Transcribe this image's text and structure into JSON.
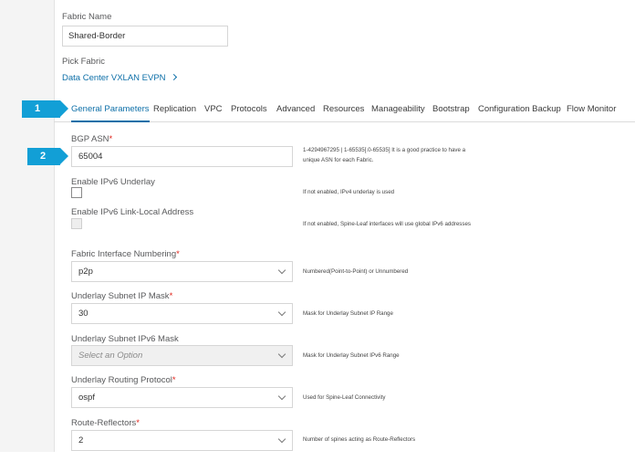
{
  "fabric_name": {
    "label": "Fabric Name",
    "value": "Shared-Border"
  },
  "pick_fabric": {
    "label": "Pick Fabric",
    "link_text": "Data Center VXLAN EVPN"
  },
  "tabs": [
    {
      "label": "General Parameters",
      "active": true
    },
    {
      "label": "Replication"
    },
    {
      "label": "VPC"
    },
    {
      "label": "Protocols"
    },
    {
      "label": "Advanced"
    },
    {
      "label": "Resources"
    },
    {
      "label": "Manageability"
    },
    {
      "label": "Bootstrap"
    },
    {
      "label": "Configuration Backup"
    },
    {
      "label": "Flow Monitor"
    }
  ],
  "callouts": {
    "one": "1",
    "two": "2"
  },
  "form": {
    "bgp_asn": {
      "label": "BGP ASN",
      "required": "*",
      "value": "65004",
      "help": "1-4294967295 | 1-65535[.0-65535] It is a good practice to have a unique ASN for each Fabric."
    },
    "ipv6_underlay": {
      "label": "Enable IPv6 Underlay",
      "checked": false,
      "help": "If not enabled, IPv4 underlay is used"
    },
    "ipv6_link_local": {
      "label": "Enable IPv6 Link-Local Address",
      "checked": false,
      "disabled": true,
      "help": "If not enabled, Spine-Leaf interfaces will use global IPv6 addresses"
    },
    "interface_numbering": {
      "label": "Fabric Interface Numbering",
      "required": "*",
      "value": "p2p",
      "help": "Numbered(Point-to-Point) or Unnumbered"
    },
    "subnet_mask": {
      "label": "Underlay Subnet IP Mask",
      "required": "*",
      "value": "30",
      "help": "Mask for Underlay Subnet IP Range"
    },
    "subnet_ipv6_mask": {
      "label": "Underlay Subnet IPv6 Mask",
      "placeholder": "Select an Option",
      "disabled": true,
      "help": "Mask for Underlay Subnet IPv6 Range"
    },
    "routing_protocol": {
      "label": "Underlay Routing Protocol",
      "required": "*",
      "value": "ospf",
      "help": "Used for Spine-Leaf Connectivity"
    },
    "route_reflectors": {
      "label": "Route-Reflectors",
      "required": "*",
      "value": "2",
      "help": "Number of spines acting as Route-Reflectors"
    }
  },
  "colors": {
    "accent": "#0d6fa8",
    "callout": "#129fd6",
    "required": "#e2231a"
  }
}
